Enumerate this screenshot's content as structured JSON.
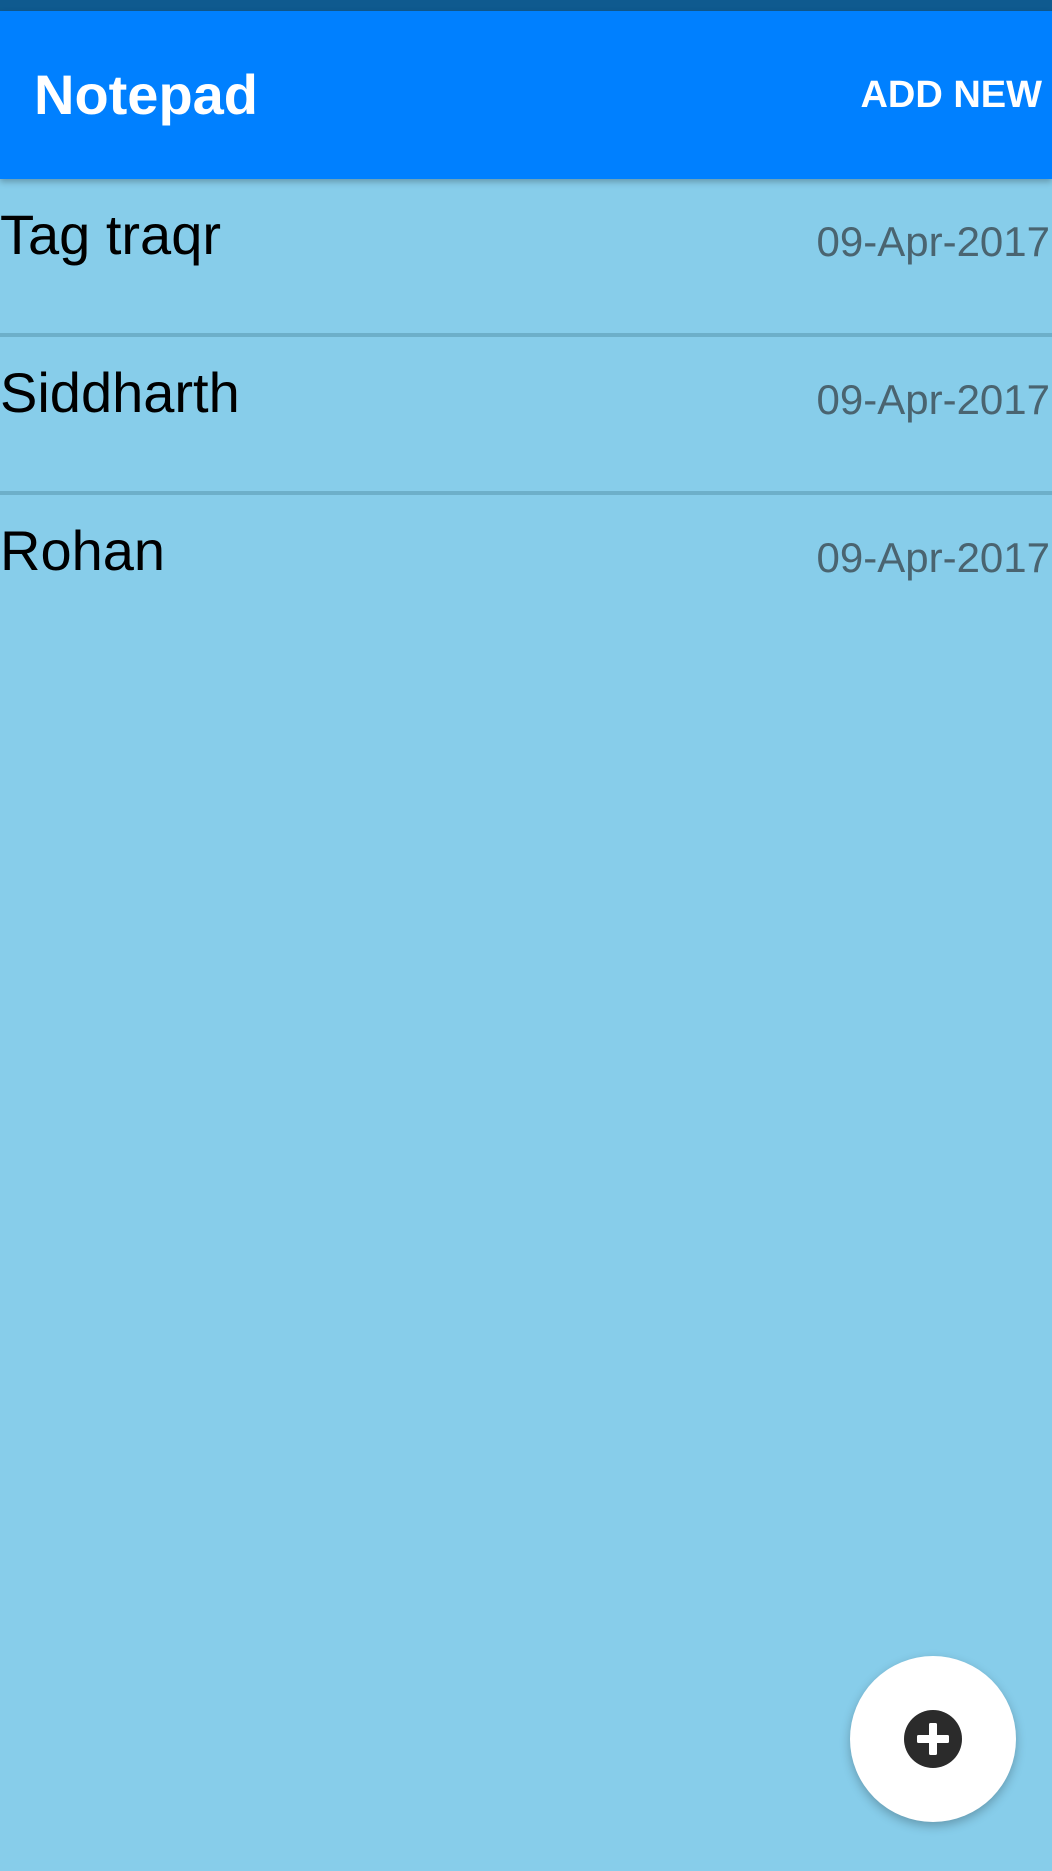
{
  "app_bar": {
    "title": "Notepad",
    "add_new_label": "ADD NEW"
  },
  "notes": [
    {
      "title": "Tag traqr",
      "date": "09-Apr-2017"
    },
    {
      "title": "Siddharth",
      "date": "09-Apr-2017"
    },
    {
      "title": "Rohan",
      "date": "09-Apr-2017"
    }
  ],
  "fab": {
    "icon": "add-circle-icon"
  },
  "colors": {
    "status_bar": "#0F5A8F",
    "app_bar": "#0080FF",
    "background": "#87CDEA",
    "divider": "#6DAFC9",
    "date_text": "#4A6470",
    "fab_background": "#FFFFFF",
    "fab_icon": "#2B2B2B"
  }
}
